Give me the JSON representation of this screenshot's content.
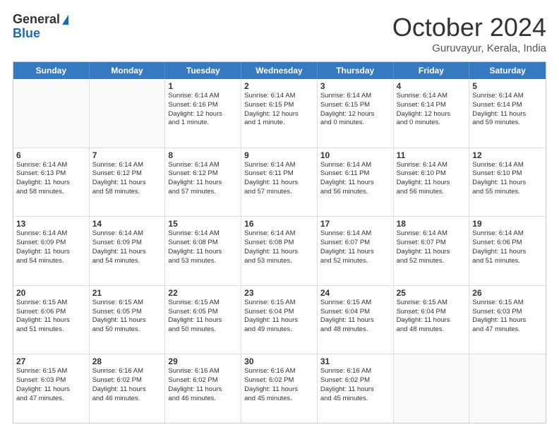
{
  "logo": {
    "general": "General",
    "blue": "Blue"
  },
  "title": {
    "month_year": "October 2024",
    "location": "Guruvayur, Kerala, India"
  },
  "header_days": [
    "Sunday",
    "Monday",
    "Tuesday",
    "Wednesday",
    "Thursday",
    "Friday",
    "Saturday"
  ],
  "weeks": [
    [
      {
        "day": "",
        "lines": [],
        "empty": true
      },
      {
        "day": "",
        "lines": [],
        "empty": true
      },
      {
        "day": "1",
        "lines": [
          "Sunrise: 6:14 AM",
          "Sunset: 6:16 PM",
          "Daylight: 12 hours",
          "and 1 minute."
        ]
      },
      {
        "day": "2",
        "lines": [
          "Sunrise: 6:14 AM",
          "Sunset: 6:15 PM",
          "Daylight: 12 hours",
          "and 1 minute."
        ]
      },
      {
        "day": "3",
        "lines": [
          "Sunrise: 6:14 AM",
          "Sunset: 6:15 PM",
          "Daylight: 12 hours",
          "and 0 minutes."
        ]
      },
      {
        "day": "4",
        "lines": [
          "Sunrise: 6:14 AM",
          "Sunset: 6:14 PM",
          "Daylight: 12 hours",
          "and 0 minutes."
        ]
      },
      {
        "day": "5",
        "lines": [
          "Sunrise: 6:14 AM",
          "Sunset: 6:14 PM",
          "Daylight: 11 hours",
          "and 59 minutes."
        ]
      }
    ],
    [
      {
        "day": "6",
        "lines": [
          "Sunrise: 6:14 AM",
          "Sunset: 6:13 PM",
          "Daylight: 11 hours",
          "and 58 minutes."
        ]
      },
      {
        "day": "7",
        "lines": [
          "Sunrise: 6:14 AM",
          "Sunset: 6:12 PM",
          "Daylight: 11 hours",
          "and 58 minutes."
        ]
      },
      {
        "day": "8",
        "lines": [
          "Sunrise: 6:14 AM",
          "Sunset: 6:12 PM",
          "Daylight: 11 hours",
          "and 57 minutes."
        ]
      },
      {
        "day": "9",
        "lines": [
          "Sunrise: 6:14 AM",
          "Sunset: 6:11 PM",
          "Daylight: 11 hours",
          "and 57 minutes."
        ]
      },
      {
        "day": "10",
        "lines": [
          "Sunrise: 6:14 AM",
          "Sunset: 6:11 PM",
          "Daylight: 11 hours",
          "and 56 minutes."
        ]
      },
      {
        "day": "11",
        "lines": [
          "Sunrise: 6:14 AM",
          "Sunset: 6:10 PM",
          "Daylight: 11 hours",
          "and 56 minutes."
        ]
      },
      {
        "day": "12",
        "lines": [
          "Sunrise: 6:14 AM",
          "Sunset: 6:10 PM",
          "Daylight: 11 hours",
          "and 55 minutes."
        ]
      }
    ],
    [
      {
        "day": "13",
        "lines": [
          "Sunrise: 6:14 AM",
          "Sunset: 6:09 PM",
          "Daylight: 11 hours",
          "and 54 minutes."
        ]
      },
      {
        "day": "14",
        "lines": [
          "Sunrise: 6:14 AM",
          "Sunset: 6:09 PM",
          "Daylight: 11 hours",
          "and 54 minutes."
        ]
      },
      {
        "day": "15",
        "lines": [
          "Sunrise: 6:14 AM",
          "Sunset: 6:08 PM",
          "Daylight: 11 hours",
          "and 53 minutes."
        ]
      },
      {
        "day": "16",
        "lines": [
          "Sunrise: 6:14 AM",
          "Sunset: 6:08 PM",
          "Daylight: 11 hours",
          "and 53 minutes."
        ]
      },
      {
        "day": "17",
        "lines": [
          "Sunrise: 6:14 AM",
          "Sunset: 6:07 PM",
          "Daylight: 11 hours",
          "and 52 minutes."
        ]
      },
      {
        "day": "18",
        "lines": [
          "Sunrise: 6:14 AM",
          "Sunset: 6:07 PM",
          "Daylight: 11 hours",
          "and 52 minutes."
        ]
      },
      {
        "day": "19",
        "lines": [
          "Sunrise: 6:14 AM",
          "Sunset: 6:06 PM",
          "Daylight: 11 hours",
          "and 51 minutes."
        ]
      }
    ],
    [
      {
        "day": "20",
        "lines": [
          "Sunrise: 6:15 AM",
          "Sunset: 6:06 PM",
          "Daylight: 11 hours",
          "and 51 minutes."
        ]
      },
      {
        "day": "21",
        "lines": [
          "Sunrise: 6:15 AM",
          "Sunset: 6:05 PM",
          "Daylight: 11 hours",
          "and 50 minutes."
        ]
      },
      {
        "day": "22",
        "lines": [
          "Sunrise: 6:15 AM",
          "Sunset: 6:05 PM",
          "Daylight: 11 hours",
          "and 50 minutes."
        ]
      },
      {
        "day": "23",
        "lines": [
          "Sunrise: 6:15 AM",
          "Sunset: 6:04 PM",
          "Daylight: 11 hours",
          "and 49 minutes."
        ]
      },
      {
        "day": "24",
        "lines": [
          "Sunrise: 6:15 AM",
          "Sunset: 6:04 PM",
          "Daylight: 11 hours",
          "and 48 minutes."
        ]
      },
      {
        "day": "25",
        "lines": [
          "Sunrise: 6:15 AM",
          "Sunset: 6:04 PM",
          "Daylight: 11 hours",
          "and 48 minutes."
        ]
      },
      {
        "day": "26",
        "lines": [
          "Sunrise: 6:15 AM",
          "Sunset: 6:03 PM",
          "Daylight: 11 hours",
          "and 47 minutes."
        ]
      }
    ],
    [
      {
        "day": "27",
        "lines": [
          "Sunrise: 6:15 AM",
          "Sunset: 6:03 PM",
          "Daylight: 11 hours",
          "and 47 minutes."
        ]
      },
      {
        "day": "28",
        "lines": [
          "Sunrise: 6:16 AM",
          "Sunset: 6:02 PM",
          "Daylight: 11 hours",
          "and 46 minutes."
        ]
      },
      {
        "day": "29",
        "lines": [
          "Sunrise: 6:16 AM",
          "Sunset: 6:02 PM",
          "Daylight: 11 hours",
          "and 46 minutes."
        ]
      },
      {
        "day": "30",
        "lines": [
          "Sunrise: 6:16 AM",
          "Sunset: 6:02 PM",
          "Daylight: 11 hours",
          "and 45 minutes."
        ]
      },
      {
        "day": "31",
        "lines": [
          "Sunrise: 6:16 AM",
          "Sunset: 6:02 PM",
          "Daylight: 11 hours",
          "and 45 minutes."
        ]
      },
      {
        "day": "",
        "lines": [],
        "empty": true
      },
      {
        "day": "",
        "lines": [],
        "empty": true
      }
    ]
  ]
}
